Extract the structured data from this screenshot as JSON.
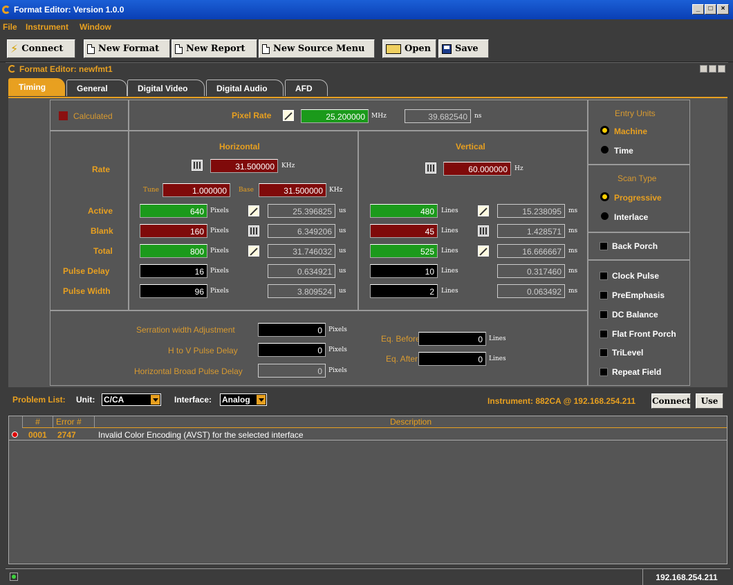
{
  "window": {
    "title": "Format Editor: Version 1.0.0"
  },
  "menu": [
    {
      "label": "File",
      "accel": "F"
    },
    {
      "label": "Instrument",
      "accel": "I"
    },
    {
      "label": "Window",
      "accel": "W"
    }
  ],
  "toolbar": {
    "connect": "Connect",
    "new_format": "New Format",
    "new_report": "New Report",
    "new_source_menu": "New Source Menu",
    "open": "Open",
    "save": "Save"
  },
  "subwindow": {
    "title": "Format Editor: newfmt1"
  },
  "tabs": [
    "Timing",
    "General",
    "Digital Video",
    "Digital Audio",
    "AFD"
  ],
  "timing": {
    "calculated_label": "Calculated",
    "pixel_rate_label": "Pixel Rate",
    "pixel_rate_value": "25.200000",
    "pixel_rate_unit": "MHz",
    "pixel_period_value": "39.682540",
    "pixel_period_unit": "ns",
    "horizontal_header": "Horizontal",
    "vertical_header": "Vertical",
    "rows": {
      "rate": "Rate",
      "active": "Active",
      "blank": "Blank",
      "total": "Total",
      "pulse_delay": "Pulse Delay",
      "pulse_width": "Pulse Width"
    },
    "h_rate_value": "31.500000",
    "h_rate_unit": "KHz",
    "tune_label": "Tune",
    "tune_value": "1.000000",
    "base_label": "Base",
    "base_value": "31.500000",
    "base_unit": "KHz",
    "v_rate_value": "60.000000",
    "v_rate_unit": "Hz",
    "h_active": "640",
    "h_active_time": "25.396825",
    "h_blank": "160",
    "h_blank_time": "6.349206",
    "h_total": "800",
    "h_total_time": "31.746032",
    "h_pulse_delay": "16",
    "h_pulse_delay_time": "0.634921",
    "h_pulse_width": "96",
    "h_pulse_width_time": "3.809524",
    "h_unit": "Pixels",
    "h_time_unit": "us",
    "v_active": "480",
    "v_active_time": "15.238095",
    "v_blank": "45",
    "v_blank_time": "1.428571",
    "v_total": "525",
    "v_total_time": "16.666667",
    "v_pulse_delay": "10",
    "v_pulse_delay_time": "0.317460",
    "v_pulse_width": "2",
    "v_pulse_width_time": "0.063492",
    "v_unit": "Lines",
    "v_time_unit": "ms",
    "serration_label": "Serration width Adjustment",
    "serration_value": "0",
    "h_to_v_label": "H to V Pulse Delay",
    "h_to_v_value": "0",
    "hbroad_label": "Horizontal Broad Pulse Delay",
    "hbroad_value": "0",
    "eq_before_label": "Eq. Before",
    "eq_before_value": "0",
    "eq_after_label": "Eq. After",
    "eq_after_value": "0",
    "entry_units_label": "Entry Units",
    "machine_label": "Machine",
    "time_label": "Time",
    "scan_type_label": "Scan Type",
    "progressive_label": "Progressive",
    "interlace_label": "Interlace",
    "back_porch_label": "Back Porch",
    "options": [
      "Clock Pulse",
      "PreEmphasis",
      "DC Balance",
      "Flat Front Porch",
      "TriLevel",
      "Repeat Field"
    ]
  },
  "problem_list": {
    "label": "Problem List:",
    "unit_label": "Unit:",
    "unit_value": "C/CA",
    "interface_label": "Interface:",
    "interface_value": "Analog",
    "instrument_text": "Instrument: 882CA @ 192.168.254.211",
    "connect_button": "Connect",
    "use_button": "Use",
    "columns": [
      "#",
      "Error #",
      "Description"
    ],
    "rows": [
      {
        "num": "0001",
        "error": "2747",
        "description": "Invalid Color Encoding (AVST) for the selected interface"
      }
    ]
  },
  "status": {
    "ip": "192.168.254.211"
  }
}
